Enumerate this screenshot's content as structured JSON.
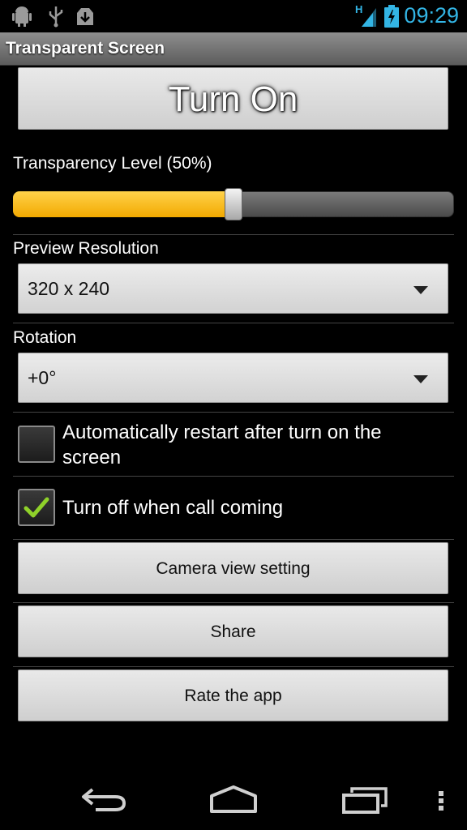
{
  "status_bar": {
    "time": "09:29",
    "network_label": "H",
    "icons": [
      "android-debug-icon",
      "usb-icon",
      "download-icon",
      "signal-icon",
      "battery-icon"
    ],
    "time_color": "#33b5e5"
  },
  "app": {
    "title": "Transparent Screen"
  },
  "main": {
    "turn_on_label": "Turn On",
    "transparency_label": "Transparency Level  (50%)",
    "transparency_value": 0.5,
    "preview_resolution_label": "Preview Resolution",
    "preview_resolution_value": "320 x 240",
    "rotation_label": "Rotation",
    "rotation_value": "+0°",
    "auto_restart_label": "Automatically restart after turn on the screen",
    "auto_restart_checked": false,
    "turn_off_call_label": "Turn off when call coming",
    "turn_off_call_checked": true,
    "camera_view_button": "Camera view setting",
    "share_button": "Share",
    "rate_button": "Rate the app"
  },
  "nav_bar": {
    "icons": [
      "back-icon",
      "home-icon",
      "recent-apps-icon",
      "overflow-menu-icon"
    ]
  },
  "colors": {
    "accent": "#f2a900",
    "check": "#8fd12a"
  }
}
